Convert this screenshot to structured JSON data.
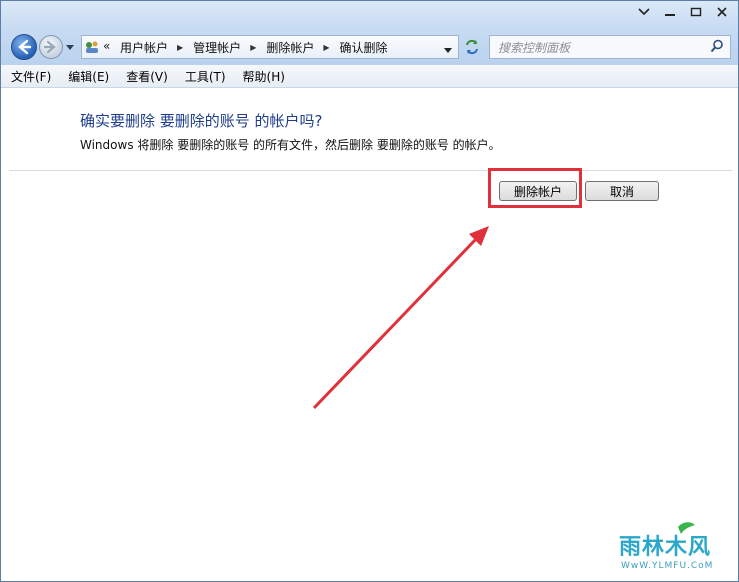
{
  "window": {
    "caption_buttons": [
      "chevron-down-icon",
      "minimize-icon",
      "maximize-icon",
      "close-icon"
    ]
  },
  "navigation": {
    "address_overflow": "«",
    "breadcrumbs": [
      "用户帐户",
      "管理帐户",
      "删除帐户",
      "确认删除"
    ],
    "search_placeholder": "搜索控制面板"
  },
  "menu": [
    "文件(F)",
    "编辑(E)",
    "查看(V)",
    "工具(T)",
    "帮助(H)"
  ],
  "dialog": {
    "heading": "确实要删除 要删除的账号 的帐户吗?",
    "description": "Windows 将删除 要删除的账号 的所有文件，然后删除 要删除的账号 的帐户。",
    "delete_button": "删除帐户",
    "cancel_button": "取消"
  },
  "annotation": {
    "highlight_color": "#e0303a",
    "arrow_color": "#e0303a"
  },
  "watermark": {
    "brand": "雨林木风",
    "url": "WwW.YLMFU.CoM"
  }
}
